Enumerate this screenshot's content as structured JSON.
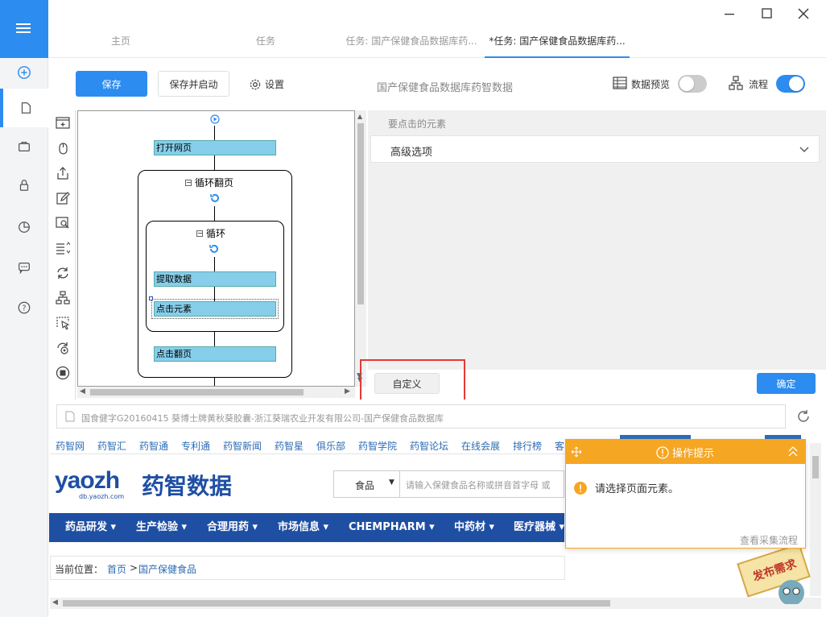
{
  "tabs": [
    {
      "label": "主页"
    },
    {
      "label": "任务"
    },
    {
      "label": "任务: 国产保健食品数据库药..."
    },
    {
      "label": "*任务: 国产保健食品数据库药..."
    }
  ],
  "toolbar": {
    "save_label": "保存",
    "save_start_label": "保存并启动",
    "settings_label": "设置",
    "task_title": "国产保健食品数据库药智数据",
    "preview_label": "数据预览",
    "preview_on": false,
    "flow_label": "流程",
    "flow_on": true
  },
  "flow": {
    "open_page": "打开网页",
    "loop_page": "循环翻页",
    "loop": "循环",
    "extract": "提取数据",
    "click_el": "点击元素",
    "click_page": "点击翻页"
  },
  "panel": {
    "header": "要点击的元素",
    "advanced": "高级选项",
    "custom_button": "自定义",
    "confirm_button": "确定"
  },
  "browser": {
    "address": "国食健字G20160415 葵博士牌黄秋葵胶囊-浙江葵瑞农业开发有限公司-国产保健食品数据库",
    "links": [
      "药智网",
      "药智汇",
      "药智通",
      "专利通",
      "药智新闻",
      "药智星",
      "俱乐部",
      "药智学院",
      "药智论坛",
      "在线会展",
      "排行榜",
      "客"
    ],
    "logo_text": "yaozh",
    "logo_sub": "db.yaozh.com",
    "logo_cn": "药智数据",
    "search_select": "食品",
    "search_placeholder": "请输入保健食品名称或拼音首字母  或",
    "nav": [
      "药品研发 ▾",
      "生产检验 ▾",
      "合理用药 ▾",
      "市场信息 ▾",
      "CHEMPHARM ▾",
      "中药材 ▾",
      "医疗器械 ▾"
    ],
    "breadcrumb_label": "当前位置：",
    "breadcrumb_home": "首页",
    "breadcrumb_sep": ">",
    "breadcrumb_current": "国产保健食品",
    "stamp": "发布需求"
  },
  "popup": {
    "title": "操作提示",
    "message": "请选择页面元素。",
    "footer_link": "查看采集流程"
  },
  "colors": {
    "accent": "#2d8cf0",
    "warning": "#f5a623",
    "highlight": "#e53935"
  }
}
